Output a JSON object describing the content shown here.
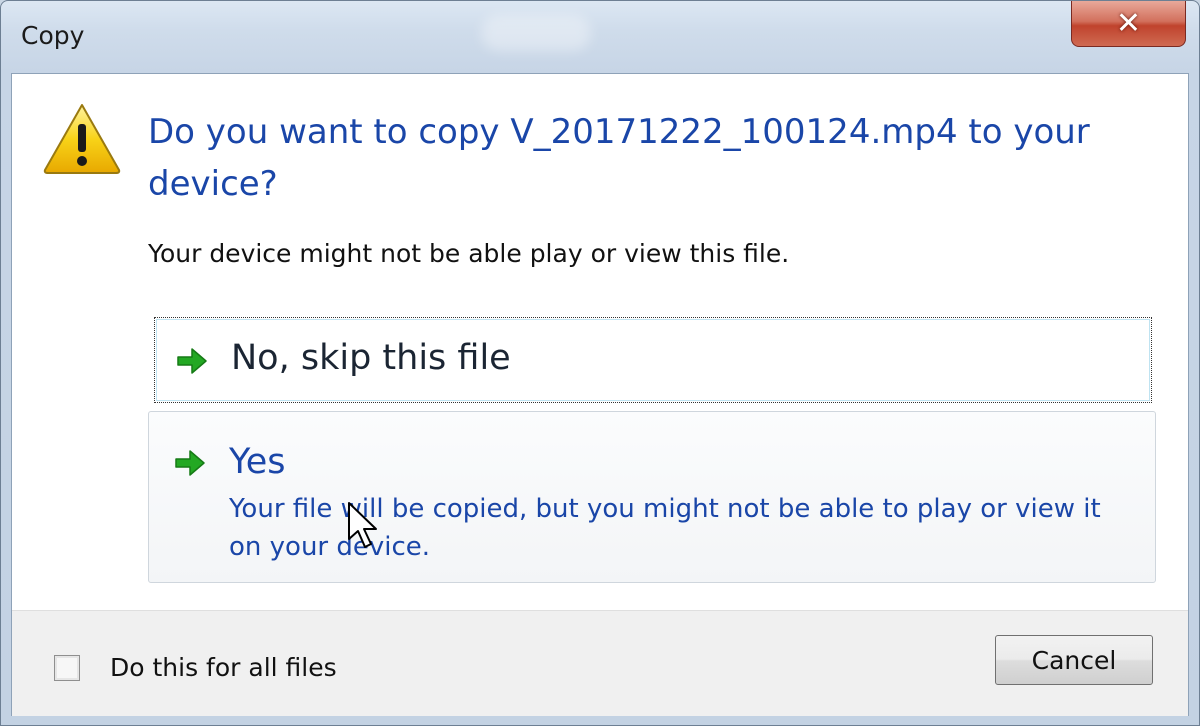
{
  "window": {
    "title": "Copy",
    "close_glyph": "✕"
  },
  "dialog": {
    "icon": "warning-triangle-icon",
    "question": "Do you want to copy V_20171222_100124.mp4 to your device?",
    "subtext": "Your device might not be able play or view this file."
  },
  "options": {
    "skip": {
      "icon": "green-arrow-icon",
      "label": "No, skip this file"
    },
    "yes": {
      "icon": "green-arrow-icon",
      "label": "Yes",
      "description": "Your file will be copied, but you might not be able to play or view it on your device."
    }
  },
  "footer": {
    "checkbox_label": "Do this for all files",
    "checkbox_checked": false,
    "cancel_label": "Cancel"
  },
  "colors": {
    "link_blue": "#1a46a8",
    "arrow_green": "#23a823",
    "warning_yellow": "#f5c400",
    "close_red": "#c0432d"
  }
}
